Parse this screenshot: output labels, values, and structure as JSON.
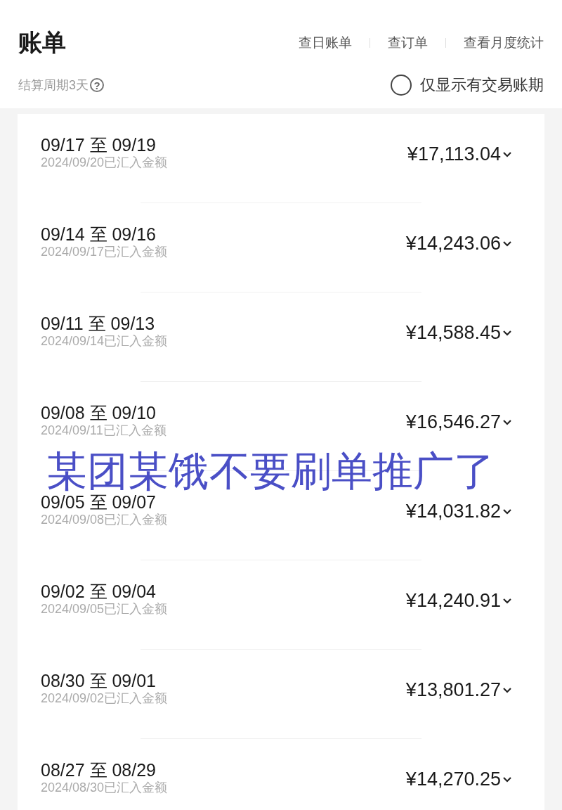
{
  "header": {
    "title": "账单",
    "links": [
      "查日账单",
      "查订单",
      "查看月度统计"
    ],
    "cycle": "结算周期3天",
    "help_icon": "?",
    "filter": {
      "label": "仅显示有交易账期",
      "checked": false
    }
  },
  "bills": [
    {
      "period": "09/17 至 09/19",
      "note": "2024/09/20已汇入金额",
      "amount": "¥17,113.04"
    },
    {
      "period": "09/14 至 09/16",
      "note": "2024/09/17已汇入金额",
      "amount": "¥14,243.06"
    },
    {
      "period": "09/11 至 09/13",
      "note": "2024/09/14已汇入金额",
      "amount": "¥14,588.45"
    },
    {
      "period": "09/08 至 09/10",
      "note": "2024/09/11已汇入金额",
      "amount": "¥16,546.27"
    },
    {
      "period": "09/05 至 09/07",
      "note": "2024/09/08已汇入金额",
      "amount": "¥14,031.82"
    },
    {
      "period": "09/02 至 09/04",
      "note": "2024/09/05已汇入金额",
      "amount": "¥14,240.91"
    },
    {
      "period": "08/30 至 09/01",
      "note": "2024/09/02已汇入金额",
      "amount": "¥13,801.27"
    },
    {
      "period": "08/27 至 08/29",
      "note": "2024/08/30已汇入金额",
      "amount": "¥14,270.25"
    }
  ],
  "caption": "某团某饿不要刷单推广了"
}
